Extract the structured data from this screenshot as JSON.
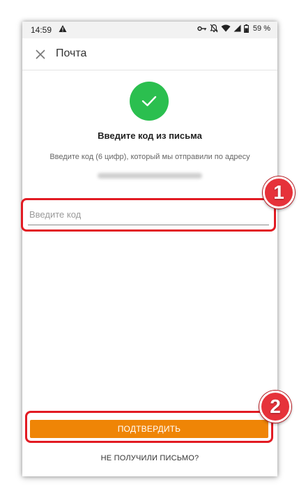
{
  "status_bar": {
    "time": "14:59",
    "battery_percent": "59 %",
    "icons": [
      "warning-icon",
      "vpn-key-icon",
      "notifications-off-icon",
      "wifi-icon",
      "signal-icon",
      "battery-icon"
    ]
  },
  "app_bar": {
    "title": "Почта",
    "close_icon": "close-icon"
  },
  "confirmation": {
    "heading": "Введите код из письма",
    "description": "Введите код (6 цифр), который мы отправили по адресу",
    "check_icon": "check-icon",
    "check_color": "#2bbf4f"
  },
  "code_input": {
    "value": "",
    "placeholder": "Введите код"
  },
  "actions": {
    "confirm_label": "ПОДТВЕРДИТЬ",
    "resend_label": "НЕ ПОЛУЧИЛИ ПИСЬМО?",
    "accent_color": "#ef8506"
  },
  "annotations": {
    "step_1": "1",
    "step_2": "2",
    "highlight_color": "#e21b23"
  }
}
